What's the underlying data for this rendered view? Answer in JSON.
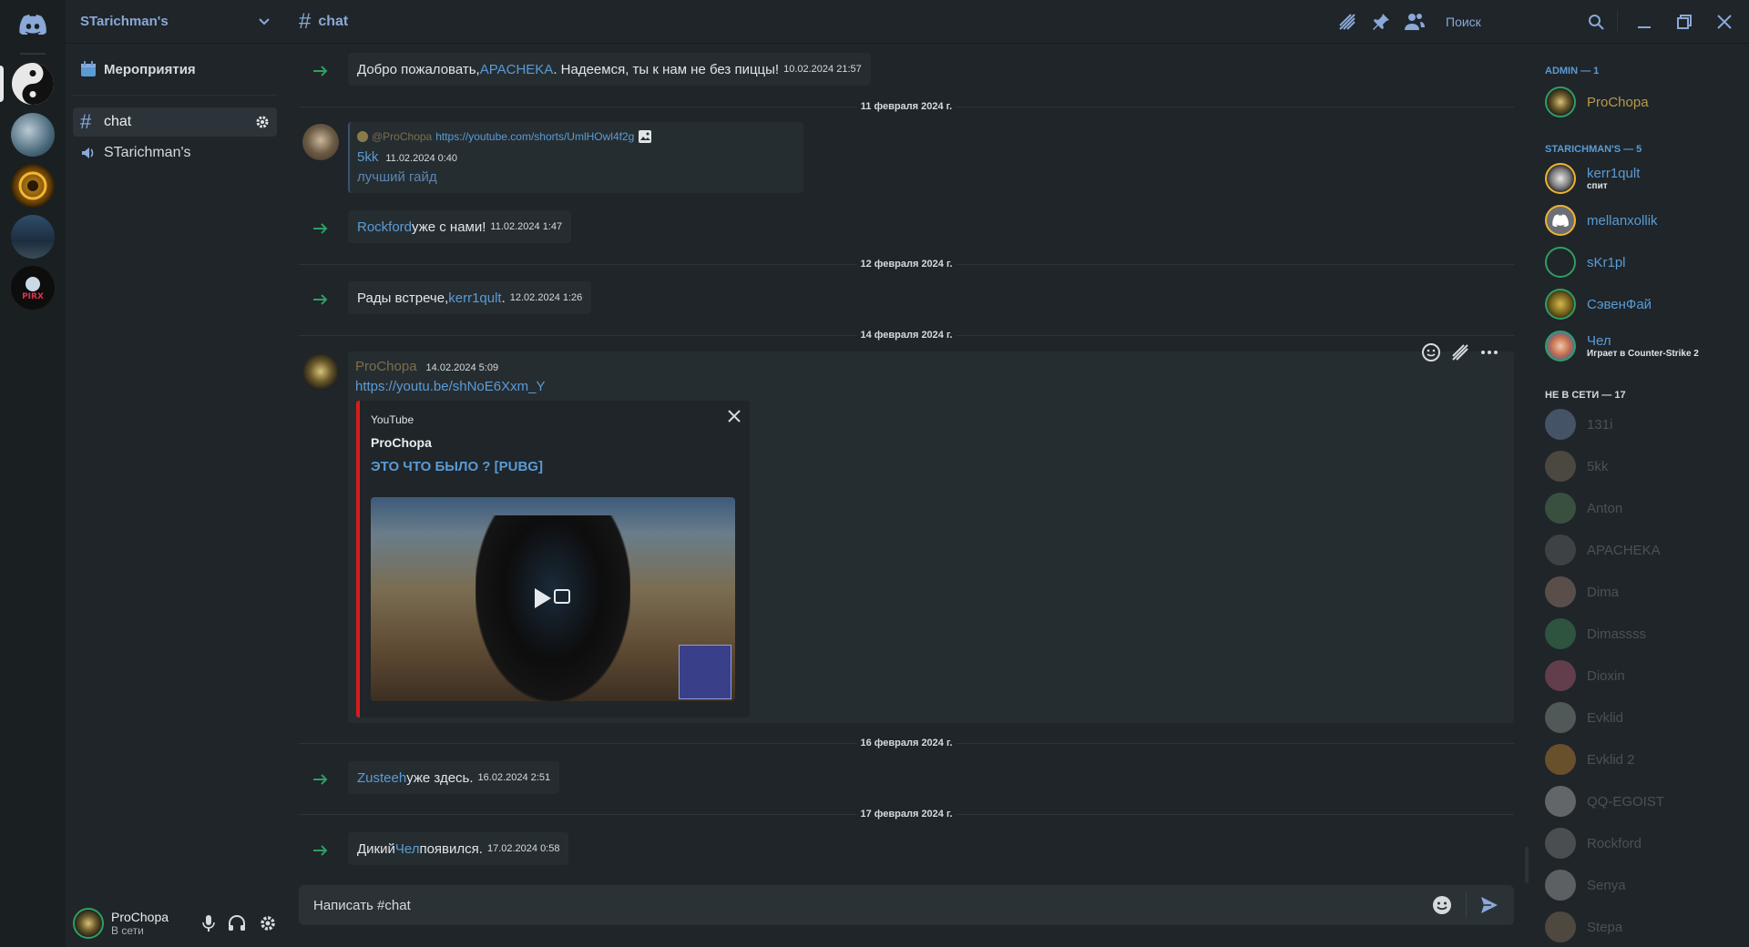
{
  "guild": {
    "name": "STarichman's"
  },
  "channels": {
    "events_label": "Мероприятия",
    "text_channel": "chat",
    "voice_channel": "STarichman's"
  },
  "user": {
    "name": "ProChopa",
    "status": "В сети"
  },
  "header": {
    "channel": "chat",
    "search_placeholder": "Поиск"
  },
  "messages": {
    "m1": {
      "prefix": "Добро пожаловать, ",
      "user": "APACHEKA",
      "suffix": ". Надеемся, ты к нам не без пиццы!",
      "time": "10.02.2024 21:57"
    },
    "d1": "11 февраля 2024 г.",
    "m2": {
      "reply_user": "@ProChopa",
      "reply_link": "https://youtube.com/shorts/UmlHOwl4f2g",
      "author": "5kk",
      "time": "11.02.2024 0:40",
      "text": "лучший гайд"
    },
    "m3": {
      "user": "Rockford",
      "suffix": " уже с нами!",
      "time": "11.02.2024 1:47"
    },
    "d2": "12 февраля 2024 г.",
    "m4": {
      "prefix": "Рады встрече, ",
      "user": "kerr1qult",
      "suffix": ".",
      "time": "12.02.2024 1:26"
    },
    "d3": "14 февраля 2024 г.",
    "m5": {
      "author": "ProChopa",
      "time": "14.02.2024 5:09",
      "link": "https://youtu.be/shNoE6Xxm_Y",
      "embed": {
        "provider": "YouTube",
        "author": "ProChopa",
        "title": "ЭТО ЧТО БЫЛО ? [PUBG]"
      }
    },
    "d4": "16 февраля 2024 г.",
    "m6": {
      "user": "Zusteeh",
      "suffix": " уже здесь.",
      "time": "16.02.2024 2:51"
    },
    "d5": "17 февраля 2024 г.",
    "m7": {
      "prefix": "Дикий ",
      "user": "Чел",
      "suffix": " появился.",
      "time": "17.02.2024 0:58"
    }
  },
  "composer": {
    "placeholder": "Написать #chat"
  },
  "members": {
    "admin_header": "ADMIN — 1",
    "admin": [
      {
        "name": "ProChopa"
      }
    ],
    "role_header": "STARICHMAN'S — 5",
    "role": [
      {
        "name": "kerr1qult",
        "activity": "спит"
      },
      {
        "name": "mellanxollik"
      },
      {
        "name": "sKr1pl"
      },
      {
        "name": "СэвенФай"
      },
      {
        "name": "Чел",
        "activity": "Играет в Counter-Strike 2"
      }
    ],
    "offline_header": "НЕ В СЕТИ — 17",
    "offline": [
      {
        "name": "131i"
      },
      {
        "name": "5kk"
      },
      {
        "name": "Anton"
      },
      {
        "name": "APACHEKA"
      },
      {
        "name": "Dima"
      },
      {
        "name": "Dimassss"
      },
      {
        "name": "Dioxin"
      },
      {
        "name": "Evklid"
      },
      {
        "name": "Evklid 2"
      },
      {
        "name": "QQ-EGOIST"
      },
      {
        "name": "Rockford"
      },
      {
        "name": "Senya"
      },
      {
        "name": "Stepa"
      }
    ]
  },
  "colors": {
    "accent": "#5a9bd5",
    "header": "#8aa8d8",
    "bg": "#1f2529",
    "embed_border": "#d91b1b"
  }
}
